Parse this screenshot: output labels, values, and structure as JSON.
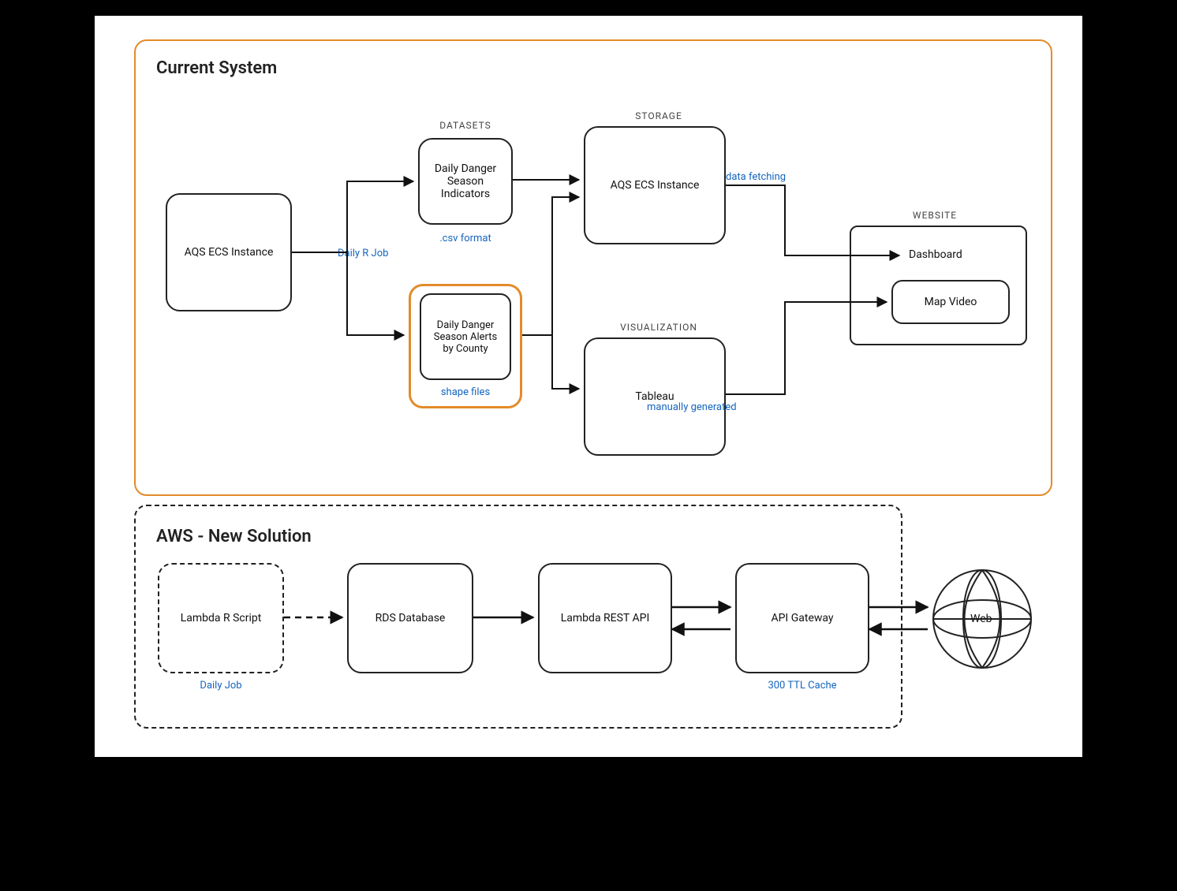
{
  "current": {
    "title": "Current System",
    "sections": {
      "datasets": "DATASETS",
      "storage": "STORAGE",
      "visualization": "VISUALIZATION",
      "website": "WEBSITE"
    },
    "nodes": {
      "aqs_source": "AQS ECS Instance",
      "indicators": "Daily Danger Season Indicators",
      "alerts": "Daily Danger Season Alerts by County",
      "aqs_storage": "AQS ECS Instance",
      "tableau": "Tableau",
      "dashboard": "Dashboard",
      "map_video": "Map Video"
    },
    "edge_labels": {
      "daily_r_job": "Daily R Job",
      "csv_format": ".csv format",
      "shape_files": "shape files",
      "data_fetching": "data fetching",
      "manually_generated": "manually generated"
    }
  },
  "new": {
    "title": "AWS - New Solution",
    "nodes": {
      "lambda_r": "Lambda R Script",
      "rds": "RDS Database",
      "lambda_api": "Lambda REST API",
      "api_gateway": "API Gateway",
      "web": "Web"
    },
    "edge_labels": {
      "daily_job": "Daily Job",
      "ttl_cache": "300 TTL Cache"
    }
  }
}
